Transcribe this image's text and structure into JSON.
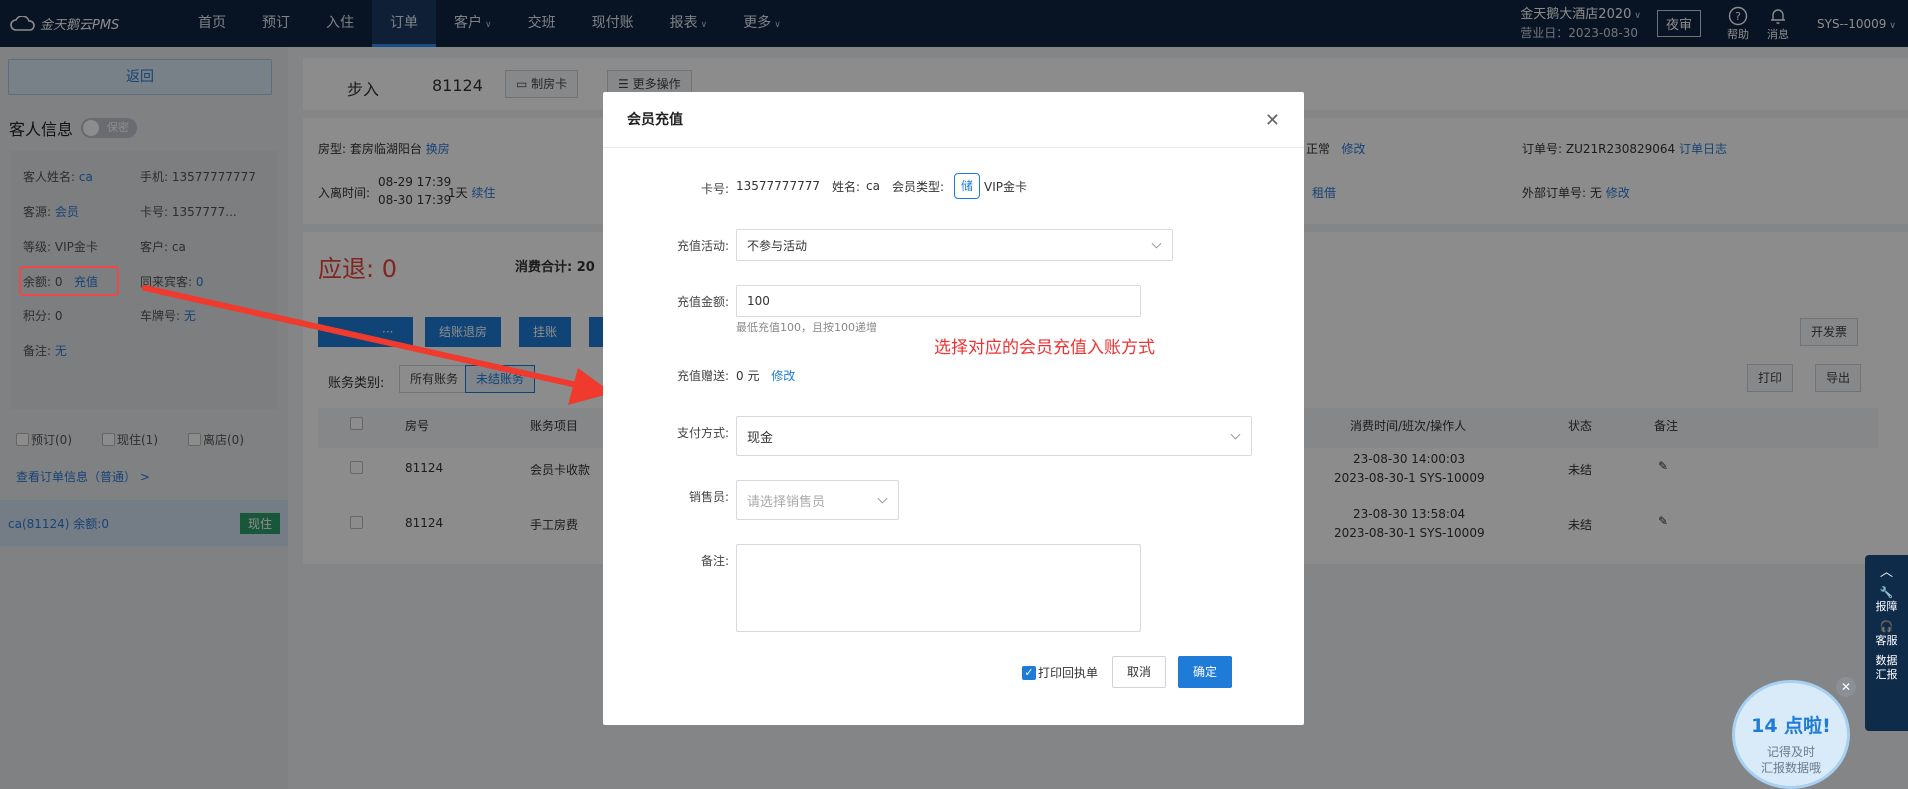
{
  "nav": {
    "logo": "金天鹅云PMS",
    "items": [
      {
        "label": "首页"
      },
      {
        "label": "预订"
      },
      {
        "label": "入住"
      },
      {
        "label": "订单"
      },
      {
        "label": "客户"
      },
      {
        "label": "交班"
      },
      {
        "label": "现付账"
      },
      {
        "label": "报表"
      },
      {
        "label": "更多"
      }
    ],
    "hotel": "金天鹅大酒店2020",
    "business_date": "营业日：2023-08-30",
    "night_audit": "夜审",
    "help": "帮助",
    "messages": "消息",
    "user": "SYS--10009"
  },
  "left": {
    "back": "返回",
    "guest_info": "客人信息",
    "secret": "保密",
    "fields": {
      "name_label": "客人姓名:",
      "name": "ca",
      "phone": "手机: 13577777777",
      "source_label": "客源:",
      "source": "会员",
      "card": "卡号: 1357777...",
      "level": "等级: VIP金卡",
      "customer": "客户: ca",
      "balance_label": "余额: 0",
      "recharge": "充值",
      "companions_label": "同来宾客:",
      "companions": "0",
      "points": "积分: 0",
      "plate_label": "车牌号:",
      "plate": "无",
      "remark_label": "备注:",
      "remark": "无"
    },
    "filters": [
      "预订(0)",
      "现住(1)",
      "离店(0)"
    ],
    "order_link": "查看订单信息（普通）  >",
    "room_row": "ca(81124)  余额:0",
    "room_badge": "现住"
  },
  "main": {
    "walk_in": "步入",
    "room": "81124",
    "make_card": "制房卡",
    "more_ops": "更多操作",
    "room_type_label": "房型:",
    "room_type": "套房临湖阳台",
    "change_room": "换房",
    "checkin_label": "入离时间:",
    "checkin_from": "08-29 17:39",
    "checkin_to": "08-30 17:39",
    "nights": "1天",
    "extend": "续住",
    "status_normal": "正常",
    "modify": "修改",
    "order_no_label": "订单号: ZU21R230829064",
    "order_log": "订单日志",
    "borrow": "租借",
    "ext_order_label": "外部订单号:  无",
    "ext_modify": "修改",
    "refund": "应退: 0",
    "consume_total": "消费合计: 20",
    "checkout_btn": "结账退房",
    "hang_btn": "挂账",
    "invoice_btn": "开发票",
    "print_btn": "打印",
    "export_btn": "导出",
    "category_label": "账务类别:",
    "cat_all": "所有账务",
    "cat_unsettled": "未结账务",
    "table": {
      "headers": [
        "房号",
        "账务项目",
        "消费时间/班次/操作人",
        "状态",
        "备注"
      ],
      "rows": [
        {
          "room": "81124",
          "item": "会员卡收款",
          "time": "23-08-30 14:00:03",
          "shift": "2023-08-30-1 SYS-10009",
          "status": "未结"
        },
        {
          "room": "81124",
          "item": "手工房费",
          "time": "23-08-30 13:58:04",
          "shift": "2023-08-30-1 SYS-10009",
          "status": "未结"
        }
      ]
    }
  },
  "modal": {
    "title": "会员充值",
    "card_label": "卡号:",
    "card_no": "13577777777",
    "name_label": "姓名:",
    "name": "ca",
    "type_label": "会员类型:",
    "type_chip": "储",
    "type": "VIP金卡",
    "activity_label": "充值活动:",
    "activity": "不参与活动",
    "amount_label": "充值金额:",
    "amount": "100",
    "amount_hint": "最低充值100，且按100递增",
    "annotation": "选择对应的会员充值入账方式",
    "gift_label": "充值赠送:",
    "gift": "0 元",
    "gift_modify": "修改",
    "payment_label": "支付方式:",
    "payment": "现金",
    "seller_label": "销售员:",
    "seller_placeholder": "请选择销售员",
    "remark_label": "备注:",
    "print_receipt": "打印回执单",
    "cancel": "取消",
    "confirm": "确定"
  },
  "side": {
    "report": "报障",
    "service": "客服",
    "data_report": "数据汇报",
    "bubble_big": "14 点啦!",
    "bubble_line1": "记得及时",
    "bubble_line2": "汇报数据哦"
  }
}
